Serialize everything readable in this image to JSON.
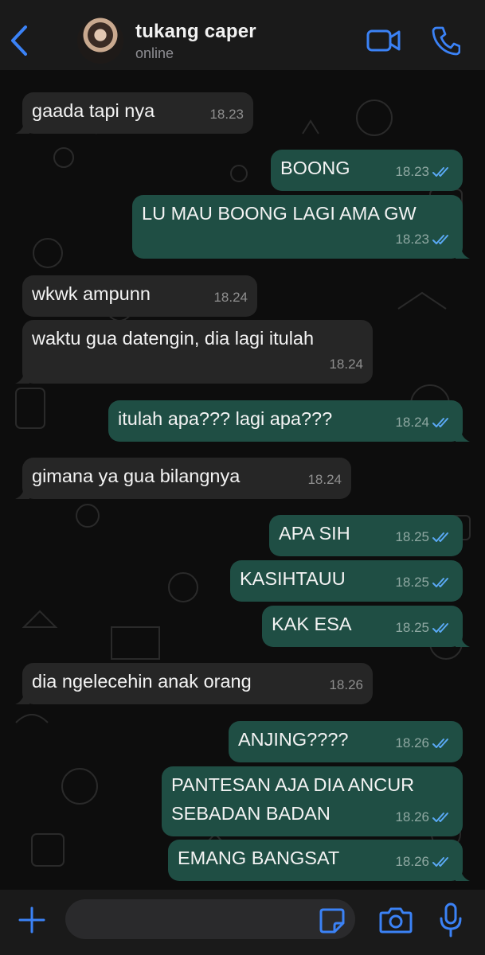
{
  "header": {
    "contact_name": "tukang caper",
    "status": "online",
    "icons": [
      "back-icon",
      "video-call-icon",
      "phone-icon"
    ]
  },
  "colors": {
    "accent": "#3b82f6",
    "incoming_bubble": "#262626",
    "outgoing_bubble": "#1f4e44",
    "read_ticks": "#5aa9f5"
  },
  "messages": [
    {
      "direction": "in",
      "text": "gaada tapi nya",
      "time": "18.23"
    },
    {
      "direction": "out",
      "text": "BOONG",
      "time": "18.23",
      "read": true
    },
    {
      "direction": "out",
      "text": "LU MAU BOONG LAGI AMA GW",
      "time": "18.23",
      "read": true
    },
    {
      "direction": "in",
      "text": "wkwk ampunn",
      "time": "18.24"
    },
    {
      "direction": "in",
      "text": "waktu gua datengin, dia lagi itulah",
      "time": "18.24"
    },
    {
      "direction": "out",
      "text": "itulah apa??? lagi apa???",
      "time": "18.24",
      "read": true
    },
    {
      "direction": "in",
      "text": "gimana ya gua bilangnya",
      "time": "18.24"
    },
    {
      "direction": "out",
      "text": "APA SIH",
      "time": "18.25",
      "read": true
    },
    {
      "direction": "out",
      "text": "KASIHTAUU",
      "time": "18.25",
      "read": true
    },
    {
      "direction": "out",
      "text": "KAK ESA",
      "time": "18.25",
      "read": true
    },
    {
      "direction": "in",
      "text": "dia ngelecehin anak orang",
      "time": "18.26"
    },
    {
      "direction": "out",
      "text": "ANJING????",
      "time": "18.26",
      "read": true
    },
    {
      "direction": "out",
      "text": "PANTESAN AJA DIA ANCUR\nSEBADAN BADAN",
      "time": "18.26",
      "read": true
    },
    {
      "direction": "out",
      "text": "EMANG BANGSAT",
      "time": "18.26",
      "read": true
    }
  ],
  "composer": {
    "placeholder": "",
    "icons": [
      "plus-icon",
      "sticker-icon",
      "camera-icon",
      "microphone-icon"
    ]
  }
}
